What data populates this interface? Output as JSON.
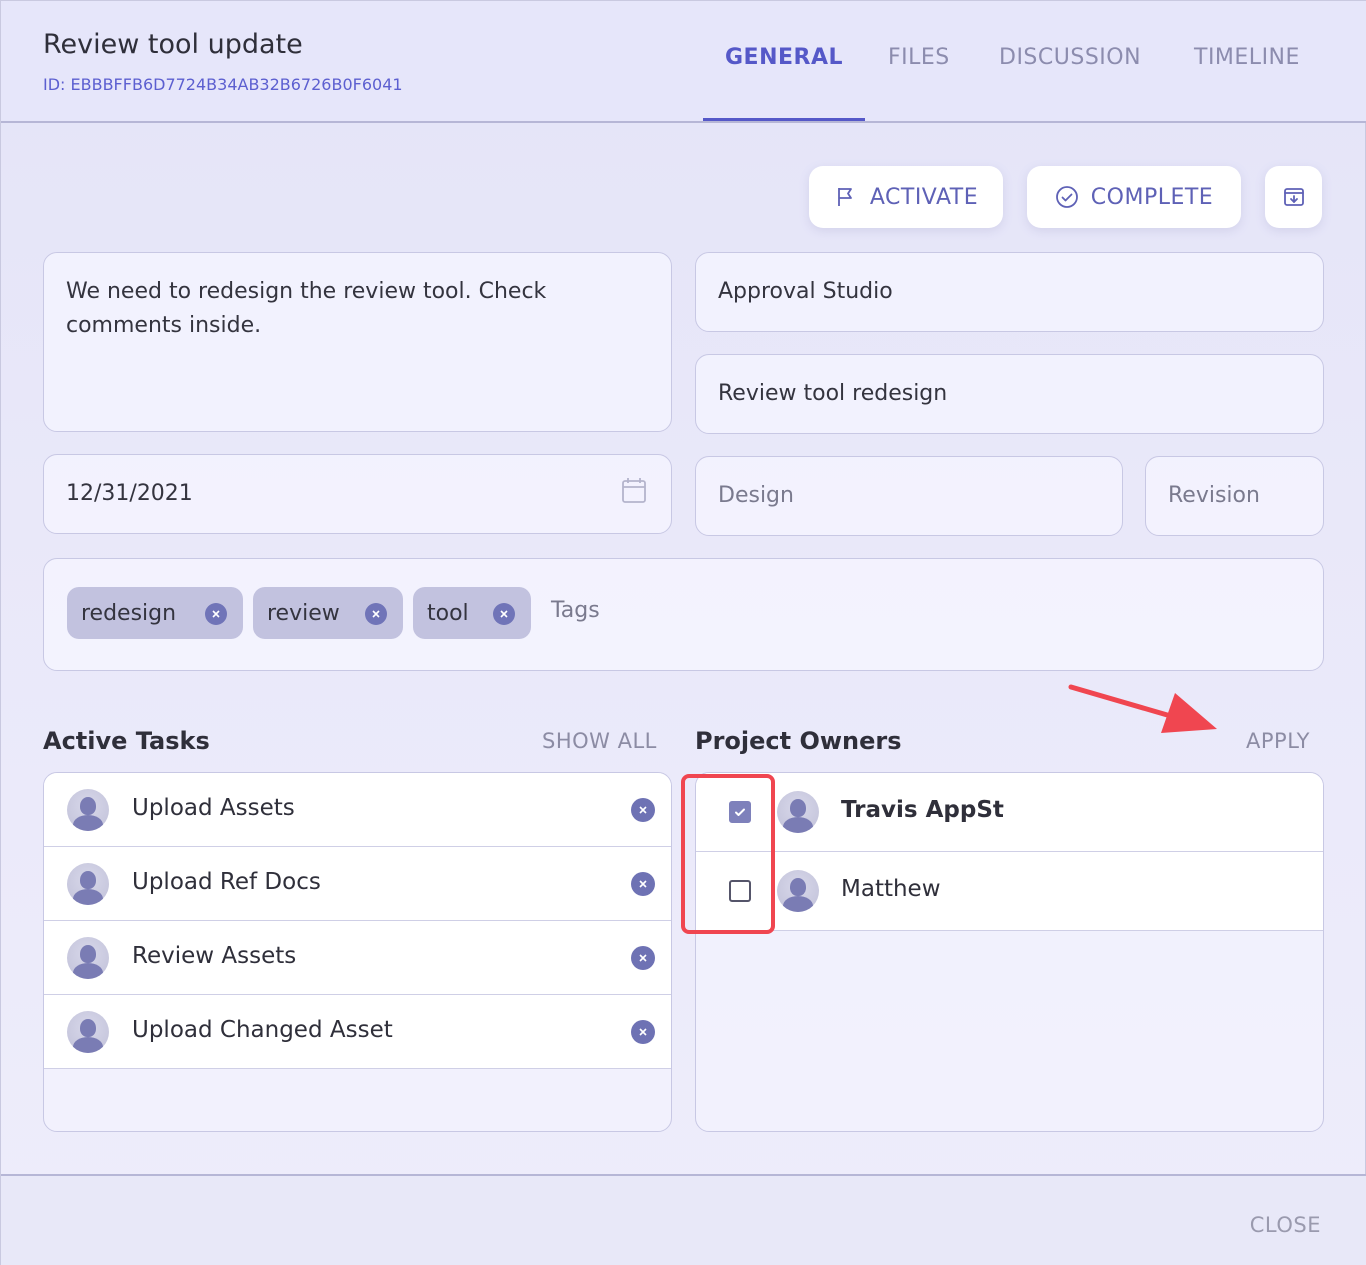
{
  "header": {
    "title": "Review tool update",
    "id_text": "ID: EBBBFFB6D7724B34AB32B6726B0F6041",
    "tabs": [
      {
        "label": "GENERAL",
        "active": true
      },
      {
        "label": "FILES",
        "active": false
      },
      {
        "label": "DISCUSSION",
        "active": false
      },
      {
        "label": "TIMELINE",
        "active": false
      }
    ]
  },
  "toolbar": {
    "activate_label": "ACTIVATE",
    "complete_label": "COMPLETE",
    "activate_icon": "flag-icon",
    "complete_icon": "check-circle-icon",
    "archive_icon": "archive-download-icon"
  },
  "form": {
    "description": "We need to redesign the review tool. Check comments inside.",
    "project": "Approval Studio",
    "subproject": "Review tool redesign",
    "due_date": "12/31/2021",
    "category_placeholder": "Design",
    "type_placeholder": "Revision",
    "tags": [
      "redesign",
      "review",
      "tool"
    ],
    "tags_placeholder": "Tags"
  },
  "active_tasks": {
    "title": "Active Tasks",
    "show_all_label": "SHOW ALL",
    "items": [
      "Upload Assets",
      "Upload Ref Docs",
      "Review Assets",
      "Upload Changed Asset"
    ]
  },
  "project_owners": {
    "title": "Project Owners",
    "apply_label": "APPLY",
    "items": [
      {
        "name": "Travis AppSt",
        "checked": true
      },
      {
        "name": "Matthew",
        "checked": false
      }
    ]
  },
  "footer": {
    "close_label": "CLOSE"
  },
  "colors": {
    "accent": "#5558c8",
    "highlight": "#f04650",
    "chip": "#c2c2df"
  }
}
